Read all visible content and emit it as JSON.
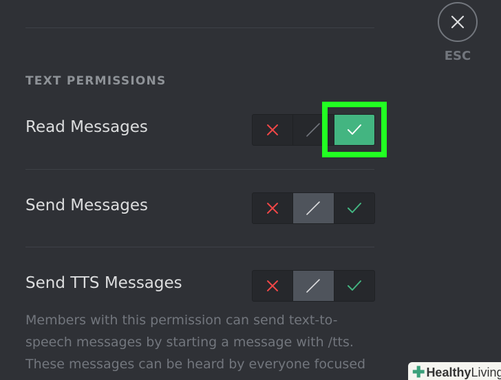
{
  "esc": {
    "label": "ESC",
    "icon": "close-icon"
  },
  "section": {
    "header": "TEXT PERMISSIONS"
  },
  "permissions": [
    {
      "label": "Read Messages",
      "state": "allow"
    },
    {
      "label": "Send Messages",
      "state": "neutral"
    },
    {
      "label": "Send TTS Messages",
      "state": "neutral"
    }
  ],
  "tts_description": {
    "line1": "Members with this permission can send text-to-",
    "line2": "speech messages by starting a message with /tts.",
    "line3": "These messages can be heard by everyone focused"
  },
  "watermark": {
    "bold": "Healthy",
    "rest": " Living"
  },
  "colors": {
    "deny": "#f04747",
    "neutral": "#4f545c",
    "allow": "#43b581",
    "highlight": "#22ff22",
    "background": "#2f3136"
  },
  "icons": {
    "deny": "x-icon",
    "neutral": "slash-icon",
    "allow": "check-icon"
  }
}
